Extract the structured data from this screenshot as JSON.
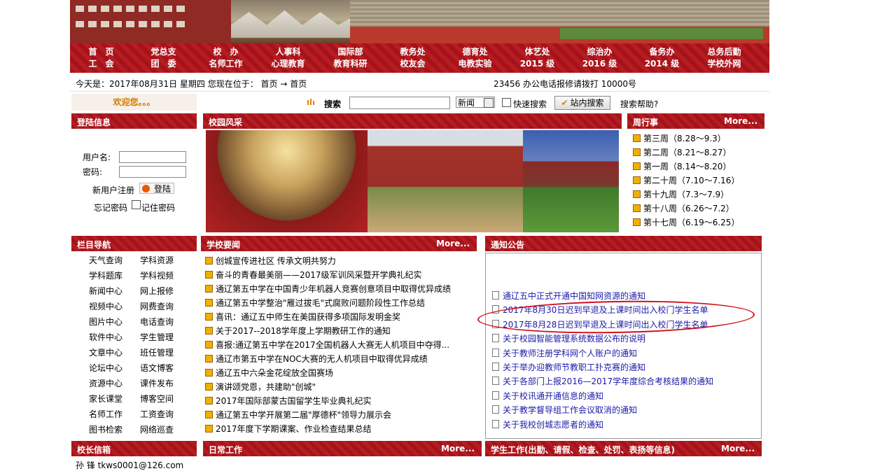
{
  "nav": [
    {
      "top": "首　页",
      "bottom": "工　会"
    },
    {
      "top": "党总支",
      "bottom": "团　委"
    },
    {
      "top": "校　办",
      "bottom": "名师工作"
    },
    {
      "top": "人事科",
      "bottom": "心理教育"
    },
    {
      "top": "国际部",
      "bottom": "教育科研"
    },
    {
      "top": "教务处",
      "bottom": "校友会"
    },
    {
      "top": "德育处",
      "bottom": "电教实验"
    },
    {
      "top": "体艺处",
      "bottom": "2015 级"
    },
    {
      "top": "综治办",
      "bottom": "2016 级"
    },
    {
      "top": "备务办",
      "bottom": "2014 级"
    },
    {
      "top": "总务后勤",
      "bottom": "学校外网"
    }
  ],
  "infobar": {
    "left": "今天是：2017年08月31日 星期四  您现在位于： 首页 → 首页",
    "marquee": "23456 办公电话报修请拨打 10000号"
  },
  "welcome": "欢迎您。。。",
  "search": {
    "label": "搜索",
    "select_value": "新闻",
    "quick_label": "快速搜索",
    "button": "站内搜索",
    "help": "搜索帮助?"
  },
  "login": {
    "title": "登陆信息",
    "username_label": "用户名:",
    "password_label": "密码:",
    "register": "新用户注册",
    "login_button": "登陆",
    "forgot": "忘记密码",
    "remember": "记住密码"
  },
  "photos": {
    "title": "校园风采"
  },
  "week": {
    "title": "周行事",
    "more": "More...",
    "items": [
      "第三周（8.28～9.3）",
      "第二周（8.21～8.27）",
      "第一周（8.14～8.20）",
      "第二十周（7.10～7.16）",
      "第十九周（7.3～7.9）",
      "第十八周（6.26～7.2）",
      "第十七周（6.19～6.25）"
    ]
  },
  "colnav": {
    "title": "栏目导航",
    "left": [
      "天气查询",
      "学科题库",
      "新闻中心",
      "视频中心",
      "图片中心",
      "软件中心",
      "文章中心",
      "论坛中心",
      "资源中心",
      "家长课堂",
      "名师工作",
      "图书检索"
    ],
    "right": [
      "学科资源",
      "学科视频",
      "网上报修",
      "网费查询",
      "电话查询",
      "学生管理",
      "班任管理",
      "语文博客",
      "课件发布",
      "博客空间",
      "工资查询",
      "网络巡查"
    ]
  },
  "news": {
    "title": "学校要闻",
    "more": "More...",
    "items": [
      "创城宣传进社区 传承文明共努力",
      "奋斗的青春最美丽——2017级军训风采暨开学典礼纪实",
      "通辽第五中学在中国青少年机器人竞赛创意项目中取得优异成绩",
      "通辽第五中学整治\"雁过拔毛\"式腐败问题阶段性工作总结",
      "喜讯：通辽五中师生在美国获得多项国际发明金奖",
      "关于2017--2018学年度上学期教研工作的通知",
      "喜报:通辽第五中学在2017全国机器人大赛无人机项目中夺得...",
      "通辽市第五中学在NOC大赛的无人机项目中取得优异成绩",
      "通辽五中六朵金花绽放全国赛场",
      "演讲颂党恩，共建助\"创城\"",
      "2017年国际部蒙古国留学生毕业典礼纪实",
      "通辽第五中学开展第二届\"厚德杯\"领导力展示会",
      "2017年度下学期课案、作业检查结果总结"
    ]
  },
  "notice": {
    "title": "通知公告",
    "items": [
      "通辽五中正式开通中国知网资源的通知",
      "2017年8月30日迟到早退及上课时间出入校门学生名单",
      "2017年8月28日迟到早退及上课时间出入校门学生名单",
      "关于校园智能管理系统数据公布的说明",
      "关于教师注册学科网个人账户的通知",
      "关于举办迎教师节教职工扑克赛的通知",
      "关于各部门上报2016—2017学年度综合考核结果的通知",
      "关于校讯通开通信息的通知",
      "关于教学督导组工作会议取消的通知",
      "关于我校创城志愿者的通知"
    ]
  },
  "bottom": {
    "principal_title": "校长信箱",
    "principal_cut": "孙  锋  tkws0001@126.com",
    "daily_title": "日常工作",
    "daily_more": "More...",
    "student_title": "学生工作(出勤、请假、检查、处罚、表扬等信息)",
    "student_more": "More..."
  },
  "colors": {
    "brand_red": "#a5131a",
    "link_blue": "#1a1aa8",
    "annotation_red": "#d0101a"
  }
}
